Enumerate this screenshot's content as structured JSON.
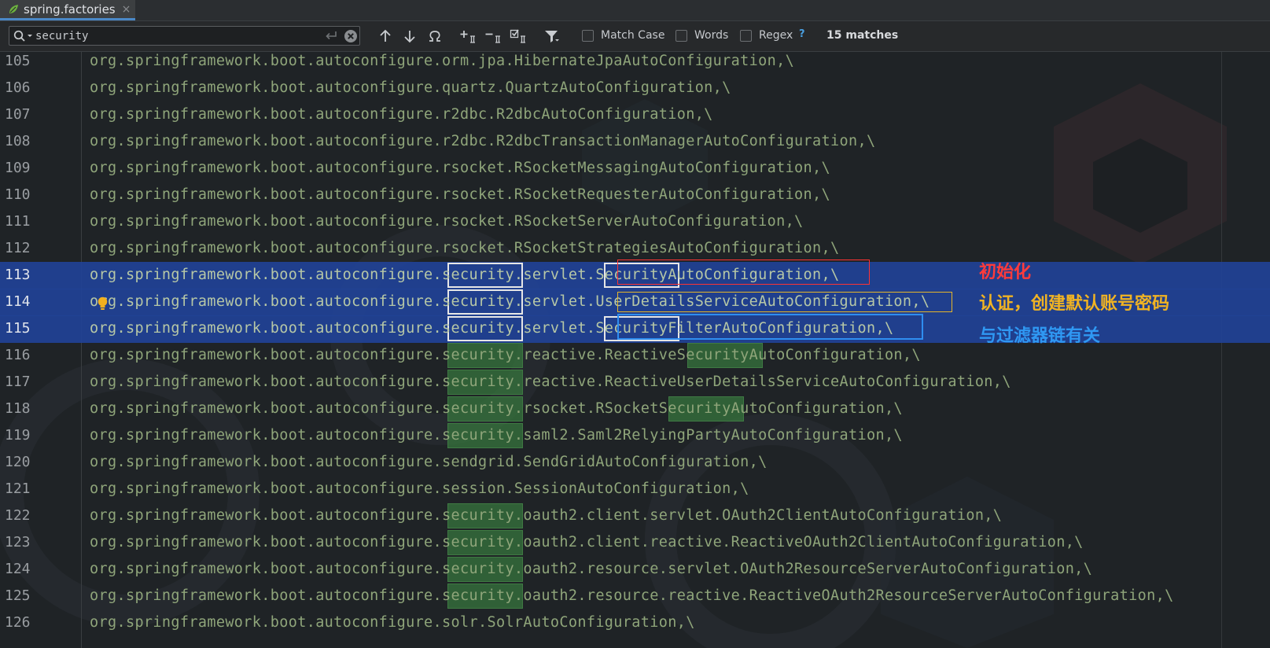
{
  "tab": {
    "title": "spring.factories",
    "close_glyph": "×",
    "icon": "spring-leaf-icon"
  },
  "find": {
    "query": "security",
    "match_case_label": "Match Case",
    "words_label": "Words",
    "regex_label": "Regex",
    "help_label": "?",
    "matches_label": "15 matches",
    "icons": [
      "search-icon",
      "enter-icon",
      "clear-icon",
      "previous-occurrence-icon",
      "next-occurrence-icon",
      "find-all-icon",
      "add-selection-icon",
      "remove-selection-icon",
      "select-all-occurrences-icon",
      "filter-icon"
    ]
  },
  "editor": {
    "lines": [
      {
        "n": "105",
        "text": "org.springframework.boot.autoconfigure.orm.jpa.HibernateJpaAutoConfiguration,\\"
      },
      {
        "n": "106",
        "text": "org.springframework.boot.autoconfigure.quartz.QuartzAutoConfiguration,\\"
      },
      {
        "n": "107",
        "text": "org.springframework.boot.autoconfigure.r2dbc.R2dbcAutoConfiguration,\\"
      },
      {
        "n": "108",
        "text": "org.springframework.boot.autoconfigure.r2dbc.R2dbcTransactionManagerAutoConfiguration,\\"
      },
      {
        "n": "109",
        "text": "org.springframework.boot.autoconfigure.rsocket.RSocketMessagingAutoConfiguration,\\"
      },
      {
        "n": "110",
        "text": "org.springframework.boot.autoconfigure.rsocket.RSocketRequesterAutoConfiguration,\\"
      },
      {
        "n": "111",
        "text": "org.springframework.boot.autoconfigure.rsocket.RSocketServerAutoConfiguration,\\"
      },
      {
        "n": "112",
        "text": "org.springframework.boot.autoconfigure.rsocket.RSocketStrategiesAutoConfiguration,\\"
      },
      {
        "n": "113",
        "text": "org.springframework.boot.autoconfigure.security.servlet.SecurityAutoConfiguration,\\"
      },
      {
        "n": "114",
        "text": "org.springframework.boot.autoconfigure.security.servlet.UserDetailsServiceAutoConfiguration,\\"
      },
      {
        "n": "115",
        "text": "org.springframework.boot.autoconfigure.security.servlet.SecurityFilterAutoConfiguration,\\"
      },
      {
        "n": "116",
        "text": "org.springframework.boot.autoconfigure.security.reactive.ReactiveSecurityAutoConfiguration,\\"
      },
      {
        "n": "117",
        "text": "org.springframework.boot.autoconfigure.security.reactive.ReactiveUserDetailsServiceAutoConfiguration,\\"
      },
      {
        "n": "118",
        "text": "org.springframework.boot.autoconfigure.security.rsocket.RSocketSecurityAutoConfiguration,\\"
      },
      {
        "n": "119",
        "text": "org.springframework.boot.autoconfigure.security.saml2.Saml2RelyingPartyAutoConfiguration,\\"
      },
      {
        "n": "120",
        "text": "org.springframework.boot.autoconfigure.sendgrid.SendGridAutoConfiguration,\\"
      },
      {
        "n": "121",
        "text": "org.springframework.boot.autoconfigure.session.SessionAutoConfiguration,\\"
      },
      {
        "n": "122",
        "text": "org.springframework.boot.autoconfigure.security.oauth2.client.servlet.OAuth2ClientAutoConfiguration,\\"
      },
      {
        "n": "123",
        "text": "org.springframework.boot.autoconfigure.security.oauth2.client.reactive.ReactiveOAuth2ClientAutoConfiguration,\\"
      },
      {
        "n": "124",
        "text": "org.springframework.boot.autoconfigure.security.oauth2.resource.servlet.OAuth2ResourceServerAutoConfiguration,\\"
      },
      {
        "n": "125",
        "text": "org.springframework.boot.autoconfigure.security.oauth2.resource.reactive.ReactiveOAuth2ResourceServerAutoConfiguration,\\"
      },
      {
        "n": "126",
        "text": "org.springframework.boot.autoconfigure.solr.SolrAutoConfiguration,\\"
      }
    ]
  },
  "annotations": [
    {
      "text": "初始化",
      "color": "#ff3b3b"
    },
    {
      "text": "认证，创建默认账号密码",
      "color": "#f0b323"
    },
    {
      "text": "与过滤器链有关",
      "color": "#2f98f3"
    }
  ],
  "colors": {
    "selection": "#214296",
    "match": "#38783e",
    "code": "#8fa57a"
  }
}
